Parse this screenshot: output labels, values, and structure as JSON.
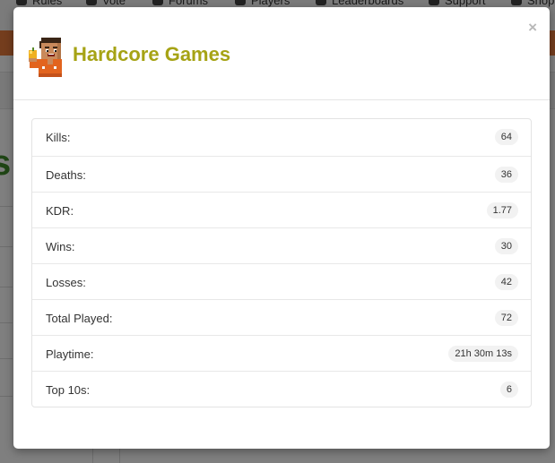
{
  "background": {
    "nav": [
      "Rules",
      "Vote",
      "Forums",
      "Players",
      "Leaderboards",
      "Support",
      "Shop"
    ]
  },
  "modal": {
    "title": "Hardcore Games",
    "close_label": "×",
    "avatar_icon": "pixel-character-avatar-icon",
    "accent_color": "#a6a315",
    "stats": [
      {
        "label": "Kills:",
        "value": "64"
      },
      {
        "label": "Deaths:",
        "value": "36"
      },
      {
        "label": "KDR:",
        "value": "1.77"
      },
      {
        "label": "Wins:",
        "value": "30"
      },
      {
        "label": "Losses:",
        "value": "42"
      },
      {
        "label": "Total Played:",
        "value": "72"
      },
      {
        "label": "Playtime:",
        "value": "21h 30m 13s"
      },
      {
        "label": "Top 10s:",
        "value": "6"
      }
    ]
  }
}
